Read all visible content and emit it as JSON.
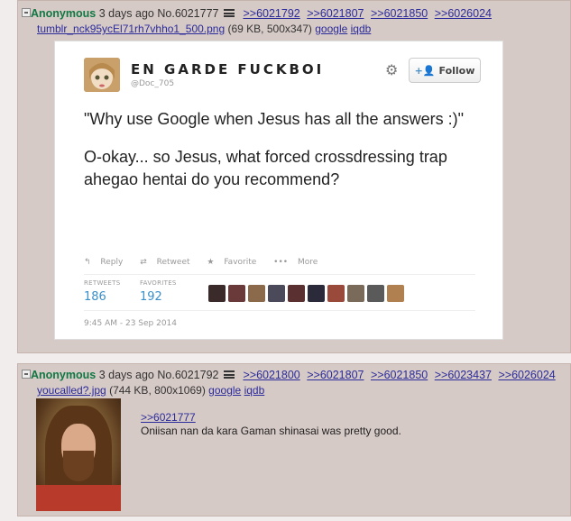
{
  "post1": {
    "name": "Anonymous",
    "date": "3 days ago",
    "post_no": "No.6021777",
    "replies": [
      ">>6021792",
      ">>6021807",
      ">>6021850",
      ">>6026024"
    ],
    "file_name": "tumblr_nck95ycEl71rh7vhho1_500.png",
    "file_info": "(69 KB, 500x347)",
    "file_links": [
      "google",
      "iqdb"
    ],
    "tweet": {
      "display_name": "EN GARDE FUCKBOI",
      "handle": "@Doc_705",
      "follow_label": "Follow",
      "text_line1": "\"Why use Google when Jesus has all the answers :)\"",
      "text_line2": "O-okay... so Jesus, what forced crossdressing trap ahegao hentai do you recommend?",
      "actions": [
        "Reply",
        "Retweet",
        "Favorite",
        "More"
      ],
      "retweets_label": "RETWEETS",
      "retweets": "186",
      "favorites_label": "FAVORITES",
      "favorites": "192",
      "timestamp": "9:45 AM - 23 Sep 2014"
    }
  },
  "post2": {
    "name": "Anonymous",
    "date": "3 days ago",
    "post_no": "No.6021792",
    "replies": [
      ">>6021800",
      ">>6021807",
      ">>6021850",
      ">>6023437",
      ">>6026024"
    ],
    "file_name": "youcalled?.jpg",
    "file_info": "(744 KB, 800x1069)",
    "file_links": [
      "google",
      "iqdb"
    ],
    "quote_link": ">>6021777",
    "body": "Oniisan nan da kara Gaman shinasai was pretty good."
  }
}
